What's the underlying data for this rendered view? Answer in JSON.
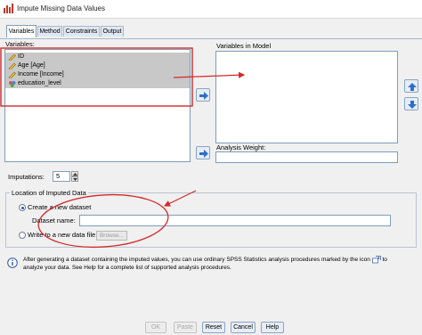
{
  "window": {
    "title": "Impute Missing Data Values"
  },
  "tabs": [
    {
      "label": "Variables",
      "active": true
    },
    {
      "label": "Method",
      "active": false
    },
    {
      "label": "Constraints",
      "active": false
    },
    {
      "label": "Output",
      "active": false
    }
  ],
  "variables": {
    "label": "Variables:",
    "items": [
      {
        "label": "ID",
        "icon": "scale-ruler-icon"
      },
      {
        "label": "Age [Age]",
        "icon": "scale-ruler-icon"
      },
      {
        "label": "Income [Income]",
        "icon": "scale-ruler-icon"
      },
      {
        "label": "education_level",
        "icon": "nominal-icon"
      }
    ]
  },
  "model": {
    "label": "Variables in Model"
  },
  "analysis_weight": {
    "label": "Analysis Weight:",
    "value": ""
  },
  "imputations": {
    "label": "Imputations:",
    "value": "5"
  },
  "location": {
    "title": "Location of Imputed Data",
    "create_label": "Create a new dataset",
    "dataset_name_label": "Dataset name:",
    "dataset_name_value": "",
    "write_label": "Write to a new data file",
    "browse_label": "Browse..."
  },
  "info": {
    "text_before": "After generating a dataset containing the imputed values, you can use ordinary SPSS Statistics analysis procedures marked by the icon",
    "text_after": "to analyze your data. See Help for a complete list of supported analysis procedures."
  },
  "buttons": {
    "ok": "OK",
    "paste": "Paste",
    "reset": "Reset",
    "cancel": "Cancel",
    "help": "Help"
  },
  "colors": {
    "annotation": "#d42a2a",
    "selection": "#c8c8c8"
  }
}
